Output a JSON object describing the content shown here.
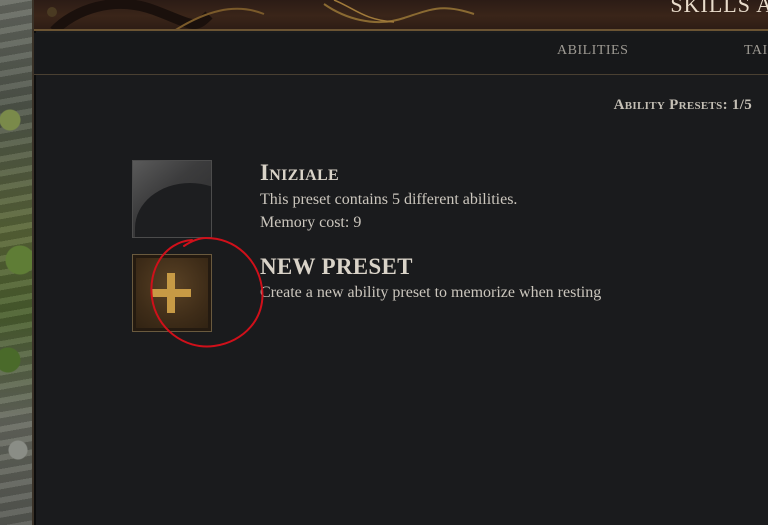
{
  "header": {
    "title": "SKILLS AN"
  },
  "tabs": [
    {
      "label": "ABILITIES"
    },
    {
      "label": "TAI"
    }
  ],
  "presets_count": "Ability Presets: 1/5",
  "presets": [
    {
      "name": "Iniziale",
      "description": "This preset contains 5 different abilities.",
      "memory_cost": "Memory cost: 9"
    }
  ],
  "new_preset": {
    "name": "NEW PRESET",
    "description": "Create a new ability preset to memorize when resting"
  },
  "colors": {
    "panel_bg": "#1a1b1d",
    "accent_gold": "#c79a45",
    "annotation_red": "#d0101a"
  },
  "icons": {
    "new_preset": "plus-icon",
    "preset": "preset-portrait-icon"
  }
}
